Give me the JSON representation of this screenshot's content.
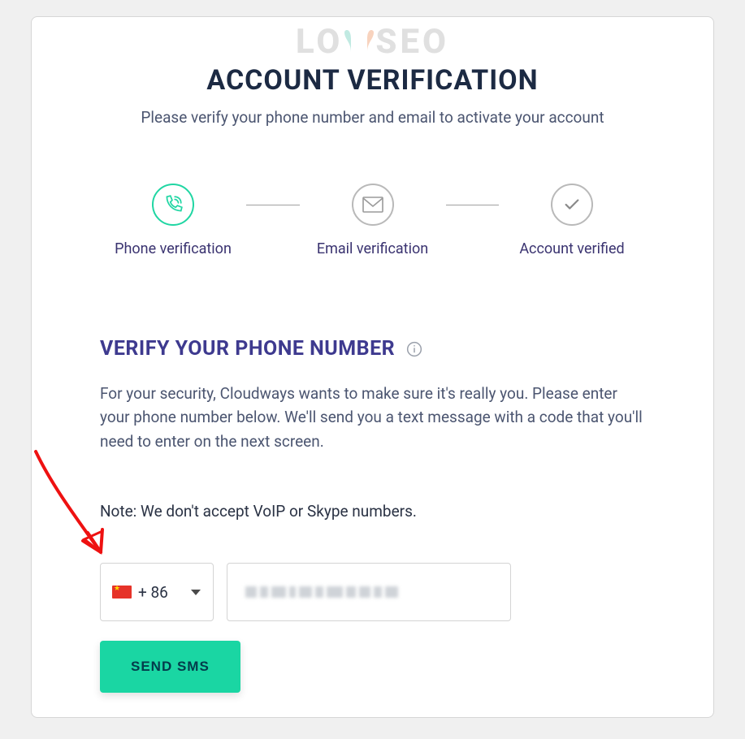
{
  "watermark": {
    "text_left": "LO",
    "text_right": "SEO"
  },
  "title": "ACCOUNT VERIFICATION",
  "subtitle": "Please verify your phone number and email to activate your account",
  "steps": {
    "phone": "Phone verification",
    "email": "Email verification",
    "verified": "Account verified"
  },
  "section": {
    "heading": "VERIFY YOUR PHONE NUMBER",
    "body": "For your security, Cloudways wants to make sure it's really you. Please enter your phone number below. We'll send you a text message with a code that you'll need to enter on the next screen.",
    "note": "Note: We don't accept VoIP or Skype numbers."
  },
  "phone": {
    "dial_code": "+ 86"
  },
  "buttons": {
    "send_sms": "SEND SMS"
  }
}
